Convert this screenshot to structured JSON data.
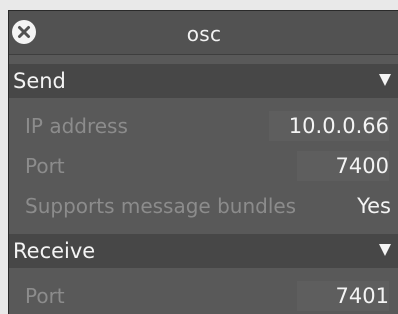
{
  "window": {
    "title": "osc",
    "close_icon": "close-circle-icon"
  },
  "send": {
    "label": "Send",
    "collapse_icon": "triangle-down-icon",
    "ip_address_label": "IP address",
    "ip_address_value": "10.0.0.66",
    "port_label": "Port",
    "port_value": "7400",
    "bundles_label": "Supports message bundles",
    "bundles_value": "Yes"
  },
  "receive": {
    "label": "Receive",
    "collapse_icon": "triangle-down-icon",
    "port_label": "Port",
    "port_value": "7401"
  },
  "colors": {
    "panel_bg": "#595959",
    "header_bg": "#474747",
    "label_text": "#8c8c8c",
    "value_text": "#f4f4f4"
  }
}
